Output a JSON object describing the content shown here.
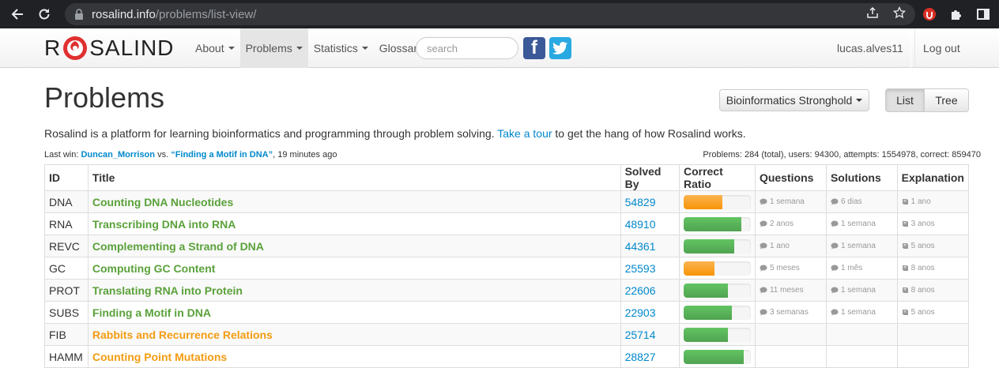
{
  "browser": {
    "url_host": "rosalind.info",
    "url_path": "/problems/list-view/"
  },
  "navbar": {
    "brand_left": "R",
    "brand_right": "SALIND",
    "items": [
      {
        "label": "About",
        "dropdown": true,
        "active": false
      },
      {
        "label": "Problems",
        "dropdown": true,
        "active": true
      },
      {
        "label": "Statistics",
        "dropdown": true,
        "active": false
      },
      {
        "label": "Glossary",
        "dropdown": false,
        "active": false
      }
    ],
    "search_placeholder": "search",
    "facebook": "f",
    "user": "lucas.alves11",
    "logout": "Log out"
  },
  "page": {
    "title": "Problems",
    "stronghold_label": "Bioinformatics Stronghold",
    "view_list": "List",
    "view_tree": "Tree",
    "intro_text": "Rosalind is a platform for learning bioinformatics and programming through problem solving.",
    "intro_link": "Take a tour",
    "intro_end": "to get the hang of how Rosalind works.",
    "lastwin_label": "Last win:",
    "lastwin_user": "Duncan_Morrison",
    "lastwin_vs": "vs.",
    "lastwin_problem": "“Finding a Motif in DNA”",
    "lastwin_time": ", 19 minutes ago",
    "stats": "Problems: 284 (total), users: 94300, attempts: 1554978, correct: 859470"
  },
  "table": {
    "headers": [
      "ID",
      "Title",
      "Solved By",
      "Correct Ratio",
      "Questions",
      "Solutions",
      "Explanation"
    ],
    "rows": [
      {
        "id": "DNA",
        "title": "Counting DNA Nucleotides",
        "color": "green",
        "solved": "54829",
        "ratio": 0.58,
        "ratio_color": "orange",
        "questions": "1 semana",
        "solutions": "6 dias",
        "explanation": "1 ano"
      },
      {
        "id": "RNA",
        "title": "Transcribing DNA into RNA",
        "color": "green",
        "solved": "48910",
        "ratio": 0.86,
        "ratio_color": "green",
        "questions": "2 anos",
        "solutions": "1 semana",
        "explanation": "3 anos"
      },
      {
        "id": "REVC",
        "title": "Complementing a Strand of DNA",
        "color": "green",
        "solved": "44361",
        "ratio": 0.75,
        "ratio_color": "green",
        "questions": "1 ano",
        "solutions": "1 semana",
        "explanation": "5 anos"
      },
      {
        "id": "GC",
        "title": "Computing GC Content",
        "color": "green",
        "solved": "25593",
        "ratio": 0.46,
        "ratio_color": "orange",
        "questions": "5 meses",
        "solutions": "1 mês",
        "explanation": "8 anos"
      },
      {
        "id": "PROT",
        "title": "Translating RNA into Protein",
        "color": "green",
        "solved": "22606",
        "ratio": 0.66,
        "ratio_color": "green",
        "questions": "11 meses",
        "solutions": "1 semana",
        "explanation": "8 anos"
      },
      {
        "id": "SUBS",
        "title": "Finding a Motif in DNA",
        "color": "green",
        "solved": "22903",
        "ratio": 0.72,
        "ratio_color": "green",
        "questions": "3 semanas",
        "solutions": "1 semana",
        "explanation": "5 anos"
      },
      {
        "id": "FIB",
        "title": "Rabbits and Recurrence Relations",
        "color": "orange",
        "solved": "25714",
        "ratio": 0.66,
        "ratio_color": "green",
        "questions": "",
        "solutions": "",
        "explanation": ""
      },
      {
        "id": "HAMM",
        "title": "Counting Point Mutations",
        "color": "orange",
        "solved": "28827",
        "ratio": 0.9,
        "ratio_color": "green",
        "questions": "",
        "solutions": "",
        "explanation": ""
      }
    ]
  }
}
